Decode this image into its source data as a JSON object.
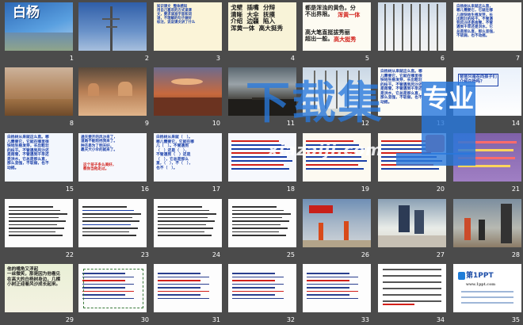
{
  "slides": [
    {
      "n": "1",
      "title": "白杨"
    },
    {
      "n": "2"
    },
    {
      "n": "3",
      "text": "知识课文  整体感知\n用自己喜欢的方式读课\n文，要求读准字音和词\n语，不理解的句子做好\n标注，说说课文讲了什么"
    },
    {
      "n": "4",
      "text": "戈壁  插嘴  分辩\n清晰  大伞  抚摸\n介绍  边疆  陷入\n浑黄一体  高大挺秀"
    },
    {
      "n": "5",
      "text": "都是浑浊的黄色，分\n不出界限。",
      "hl1": "浑黄一体",
      "text2": "高大笔直挺拔秀丽\n超出一般。",
      "hl2": "高大挺秀"
    },
    {
      "n": "6"
    },
    {
      "n": "7",
      "text": "白杨树从来就这么直，\n哪儿需要它，它就在哪\n儿很快地生根发芽，长\n出粗壮的枝干。不管遇\n到风沙还是雨雪，不管\n遇到干旱还是洪水，它\n总是那么直，那么坚强，\n不软弱，也不动摇。"
    },
    {
      "n": "8"
    },
    {
      "n": "9"
    },
    {
      "n": "10"
    },
    {
      "n": "11"
    },
    {
      "n": "12"
    },
    {
      "n": "13",
      "text": "白杨树从来就这么直。哪\n儿需要它，它就在哪里很\n快地生根发芽，长出粗壮\n的枝干。不管遇到风沙还\n是雨雪，不管遇到干旱还\n是洪水，它总是那么直，\n那么坚强，不软弱，也不\n动摇。"
    },
    {
      "n": "14",
      "text": "爸爸只是在向孩子们\n介绍白杨吗？"
    },
    {
      "n": "15",
      "text": "白杨树从来就这么直。哪\n儿需要它，它就在哪里很\n快地生根发芽，长出粗壮\n的枝干。不管遇到风沙还\n是雨雪，不管遇到干旱还\n是洪水，它总是那么直，\n那么坚强，不软弱，也不\n动摇。"
    },
    {
      "n": "16",
      "text": "通天要开的风沙来了，\n道路不能阻挡我来了。\n种花是为了明天好，\n靠天大小伞的就来了。",
      "hl1": "这个孩子多么美好，\n教你当他走过。"
    },
    {
      "n": "17",
      "text": "白杨树从来就（   ）。\n哪儿需要它，它就在哪\n儿（   ）。不管遇到\n（   ）还是（   ），\n不管遇到（   ）还是\n（   ），它总是那么\n直，（   ），不（   ），\n也不（   ）。"
    },
    {
      "n": "18"
    },
    {
      "n": "19"
    },
    {
      "n": "20"
    },
    {
      "n": "21"
    },
    {
      "n": "22"
    },
    {
      "n": "23"
    },
    {
      "n": "24"
    },
    {
      "n": "25"
    },
    {
      "n": "26"
    },
    {
      "n": "27"
    },
    {
      "n": "28"
    },
    {
      "n": "29",
      "text": "他的嘴角又浮起\n一丝微笑，那是因为他看见\n在高大的白杨树身边，几棵\n小树正迎着风沙成长起来。"
    },
    {
      "n": "30"
    },
    {
      "n": "31"
    },
    {
      "n": "32"
    },
    {
      "n": "33"
    },
    {
      "n": "34"
    },
    {
      "n": "35",
      "text": "第1PPT",
      "hl1": "www.1ppt.com"
    }
  ],
  "watermark": {
    "main": "下载集",
    "stamp": "专业",
    "url": "xiazaiji.com"
  },
  "colors": {
    "bg": "#4b4b4b",
    "blue_text": "#1a3fa8",
    "red": "#d2201a",
    "wm": "#2878dc"
  }
}
